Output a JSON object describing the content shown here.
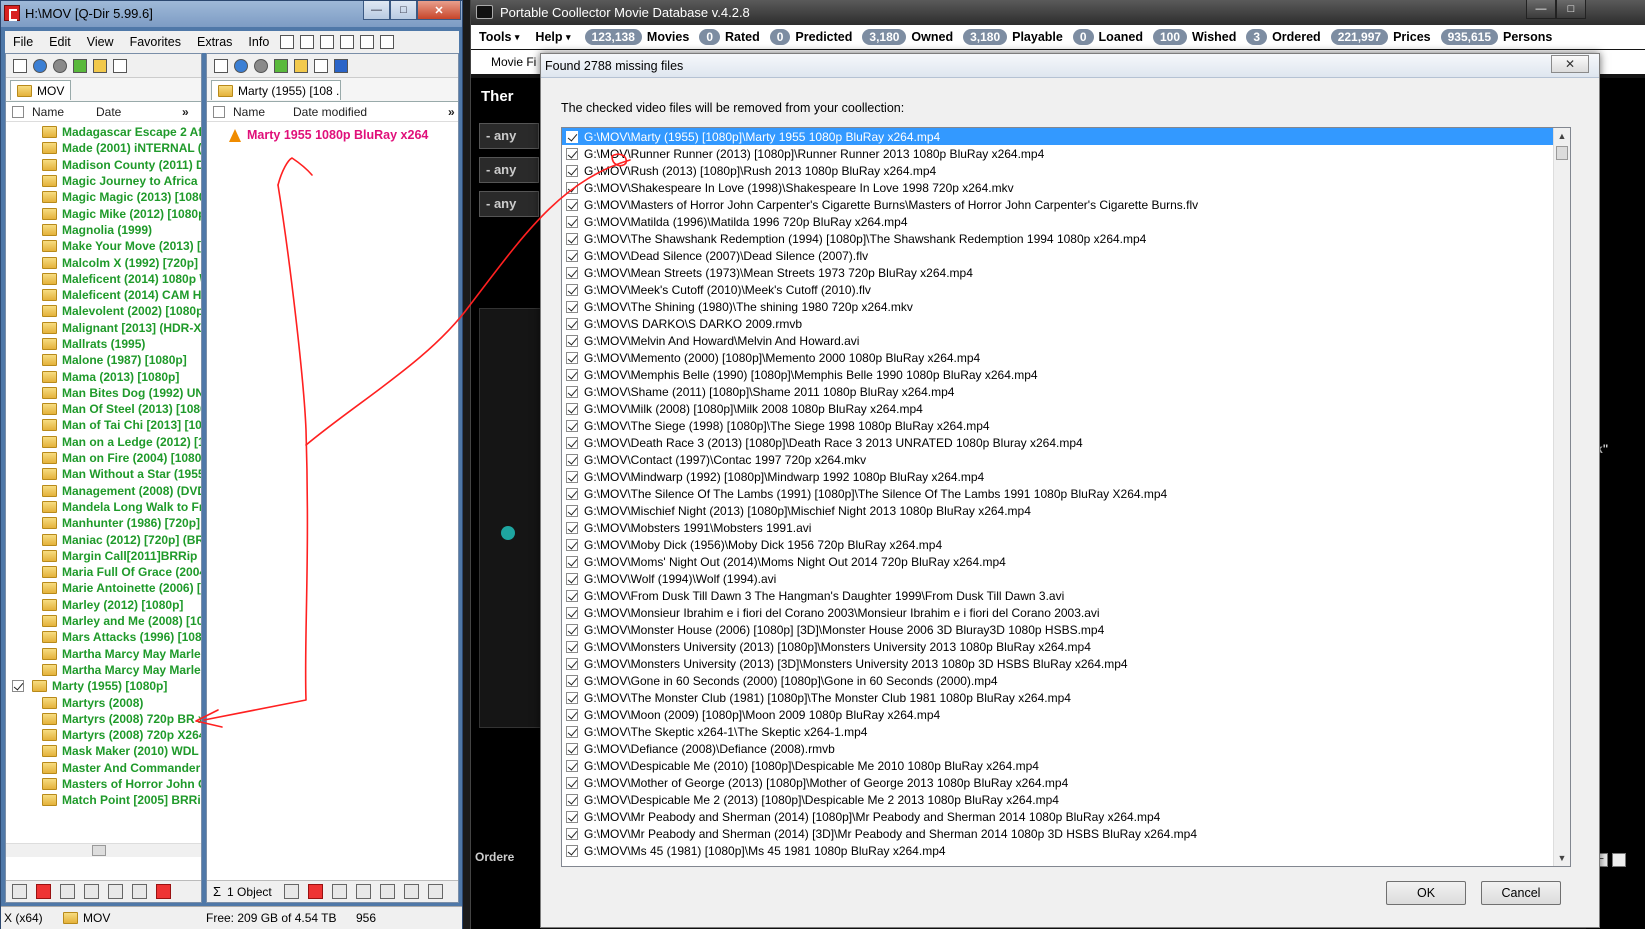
{
  "qdir": {
    "title": "H:\\MOV  [Q-Dir 5.99.6]",
    "caption_buttons": {
      "min": "—",
      "max": "□",
      "close": "✕"
    },
    "menu": [
      "File",
      "Edit",
      "View",
      "Favorites",
      "Extras",
      "Info"
    ],
    "left_pane": {
      "tab": "MOV",
      "col_name": "Name",
      "col_date": "Date",
      "col_more": "»",
      "items": [
        "Madagascar Escape 2 Afric",
        "Made (2001) iNTERNAL (D",
        "Madison County (2011) DV",
        "Magic Journey to Africa (2",
        "Magic Magic (2013) [1080",
        "Magic Mike (2012) [1080p",
        "Magnolia (1999)",
        "Make Your Move (2013) [",
        "Malcolm X (1992) [720p] E",
        "Maleficent (2014) 1080p \\",
        "Maleficent (2014) CAM H2",
        "Malevolent (2002) [1080p",
        "Malignant [2013] (HDR-X\\",
        "Mallrats (1995)",
        "Malone (1987) [1080p]",
        "Mama (2013) [1080p]",
        "Man Bites Dog (1992) UN(",
        "Man Of Steel (2013) [1080",
        "Man of Tai Chi [2013] [108",
        "Man on a Ledge (2012) [1(",
        "Man on Fire (2004) [1080p",
        "Man Without a Star (1955)",
        "Management (2008) (DVD",
        "Mandela Long Walk to Fre",
        "Manhunter (1986) [720p]",
        "Maniac (2012) [720p] (BR-",
        "Margin Call[2011]BRRip X",
        "Maria Full Of Grace (2004)",
        "Marie Antoinette (2006) [",
        "Marley (2012) [1080p]",
        "Marley and Me (2008) [10",
        "Mars Attacks (1996) [1080",
        "Martha Marcy May Marlen",
        "Martha Marcy May Marlen",
        "Marty (1955) [1080p]",
        "Martyrs (2008)",
        "Martyrs (2008) 720p BR x",
        "Martyrs (2008) 720p X264",
        "Mask Maker (2010) WDL",
        "Master And Commander (",
        "Masters of Horror John Ca",
        "Match Point [2005] BRRip"
      ],
      "selected_index": 34
    },
    "right_pane": {
      "tab": "Marty (1955) [108 ...",
      "col_name": "Name",
      "col_date": "Date modified",
      "col_more": "»",
      "file": "Marty 1955 1080p BluRay x264",
      "status": "1 Object"
    },
    "statusbar": {
      "arch": "X (x64)",
      "folder": "MOV",
      "free": "Free: 209 GB of 4.54 TB",
      "count": "956"
    }
  },
  "pcmd": {
    "title": "Portable Coollector Movie Database  v.4.2.8",
    "menu": [
      {
        "label": "Tools",
        "arrow": "▾"
      },
      {
        "label": "Help",
        "arrow": "▾"
      }
    ],
    "stats": [
      {
        "count": "123,138",
        "label": "Movies"
      },
      {
        "count": "0",
        "label": "Rated"
      },
      {
        "count": "0",
        "label": "Predicted"
      },
      {
        "count": "3,180",
        "label": "Owned"
      },
      {
        "count": "3,180",
        "label": "Playable"
      },
      {
        "count": "0",
        "label": "Loaned"
      },
      {
        "count": "100",
        "label": "Wished"
      },
      {
        "count": "3",
        "label": "Ordered"
      },
      {
        "count": "221,997",
        "label": "Prices"
      },
      {
        "count": "935,615",
        "label": "Persons"
      }
    ],
    "tab_label": "Movie Fi",
    "bg_heading": "Ther",
    "filters": [
      "- any",
      "- any",
      "- any"
    ],
    "bottom_label": "Ordere",
    "side_quote": "k\""
  },
  "dialog": {
    "title": "Found 2788 missing files",
    "close": "✕",
    "message": "The checked video files will be removed from your coollection:",
    "ok": "OK",
    "cancel": "Cancel",
    "files": [
      "G:\\MOV\\Marty (1955) [1080p]\\Marty 1955 1080p BluRay x264.mp4",
      "G:\\MOV\\Runner Runner (2013) [1080p]\\Runner Runner 2013 1080p BluRay x264.mp4",
      "G:\\MOV\\Rush (2013) [1080p]\\Rush 2013 1080p BluRay x264.mp4",
      "G:\\MOV\\Shakespeare In Love (1998)\\Shakespeare In Love 1998 720p x264.mkv",
      "G:\\MOV\\Masters of Horror John Carpenter's Cigarette Burns\\Masters of Horror John Carpenter's Cigarette Burns.flv",
      "G:\\MOV\\Matilda (1996)\\Matilda 1996 720p BluRay x264.mp4",
      "G:\\MOV\\The Shawshank Redemption (1994) [1080p]\\The Shawshank Redemption 1994 1080p x264.mp4",
      "G:\\MOV\\Dead Silence (2007)\\Dead Silence (2007).flv",
      "G:\\MOV\\Mean Streets (1973)\\Mean Streets 1973 720p BluRay x264.mp4",
      "G:\\MOV\\Meek's Cutoff (2010)\\Meek's Cutoff (2010).flv",
      "G:\\MOV\\The Shining (1980)\\The shining 1980 720p x264.mkv",
      "G:\\MOV\\S DARKO\\S DARKO 2009.rmvb",
      "G:\\MOV\\Melvin And Howard\\Melvin And Howard.avi",
      "G:\\MOV\\Memento (2000) [1080p]\\Memento 2000 1080p BluRay x264.mp4",
      "G:\\MOV\\Memphis Belle (1990) [1080p]\\Memphis Belle 1990 1080p BluRay x264.mp4",
      "G:\\MOV\\Shame (2011) [1080p]\\Shame 2011 1080p BluRay x264.mp4",
      "G:\\MOV\\Milk (2008) [1080p]\\Milk 2008 1080p BluRay x264.mp4",
      "G:\\MOV\\The Siege (1998) [1080p]\\The Siege 1998 1080p BluRay x264.mp4",
      "G:\\MOV\\Death Race 3 (2013) [1080p]\\Death Race 3 2013 UNRATED 1080p Bluray x264.mp4",
      "G:\\MOV\\Contact (1997)\\Contac 1997 720p x264.mkv",
      "G:\\MOV\\Mindwarp (1992) [1080p]\\Mindwarp 1992 1080p BluRay x264.mp4",
      "G:\\MOV\\The Silence Of The Lambs (1991) [1080p]\\The Silence Of The Lambs 1991 1080p BluRay X264.mp4",
      "G:\\MOV\\Mischief Night (2013) [1080p]\\Mischief Night 2013 1080p BluRay x264.mp4",
      "G:\\MOV\\Mobsters 1991\\Mobsters 1991.avi",
      "G:\\MOV\\Moby Dick (1956)\\Moby Dick 1956 720p BluRay x264.mp4",
      "G:\\MOV\\Moms' Night Out (2014)\\Moms Night Out 2014 720p BluRay x264.mp4",
      "G:\\MOV\\Wolf (1994)\\Wolf (1994).avi",
      "G:\\MOV\\From Dusk Till Dawn 3 The Hangman's Daughter 1999\\From Dusk Till Dawn 3.avi",
      "G:\\MOV\\Monsieur Ibrahim e i fiori del Corano 2003\\Monsieur Ibrahim e i fiori del Corano 2003.avi",
      "G:\\MOV\\Monster House (2006) [1080p] [3D]\\Monster House 2006 3D Bluray3D 1080p HSBS.mp4",
      "G:\\MOV\\Monsters University (2013) [1080p]\\Monsters University 2013 1080p BluRay x264.mp4",
      "G:\\MOV\\Monsters University (2013) [3D]\\Monsters University 2013 1080p 3D HSBS BluRay x264.mp4",
      "G:\\MOV\\Gone in 60 Seconds (2000) [1080p]\\Gone in 60 Seconds (2000).mp4",
      "G:\\MOV\\The Monster Club (1981) [1080p]\\The Monster Club 1981 1080p BluRay x264.mp4",
      "G:\\MOV\\Moon (2009) [1080p]\\Moon 2009 1080p BluRay x264.mp4",
      "G:\\MOV\\The Skeptic x264-1\\The Skeptic x264-1.mp4",
      "G:\\MOV\\Defiance (2008)\\Defiance (2008).rmvb",
      "G:\\MOV\\Despicable Me (2010) [1080p]\\Despicable Me 2010 1080p BluRay x264.mp4",
      "G:\\MOV\\Mother of George (2013) [1080p]\\Mother of George 2013 1080p BluRay x264.mp4",
      "G:\\MOV\\Despicable Me 2 (2013) [1080p]\\Despicable Me 2 2013 1080p BluRay x264.mp4",
      "G:\\MOV\\Mr Peabody and Sherman (2014) [1080p]\\Mr Peabody and Sherman 2014 1080p BluRay x264.mp4",
      "G:\\MOV\\Mr Peabody and Sherman (2014) [3D]\\Mr Peabody and Sherman 2014 1080p 3D HSBS BluRay x264.mp4",
      "G:\\MOV\\Ms 45 (1981) [1080p]\\Ms 45 1981 1080p BluRay x264.mp4"
    ]
  },
  "colors": {
    "accent_green": "#1f9a2a",
    "accent_pink": "#e0107a",
    "annotation_red": "#ff2020",
    "selection": "#3399ff"
  }
}
